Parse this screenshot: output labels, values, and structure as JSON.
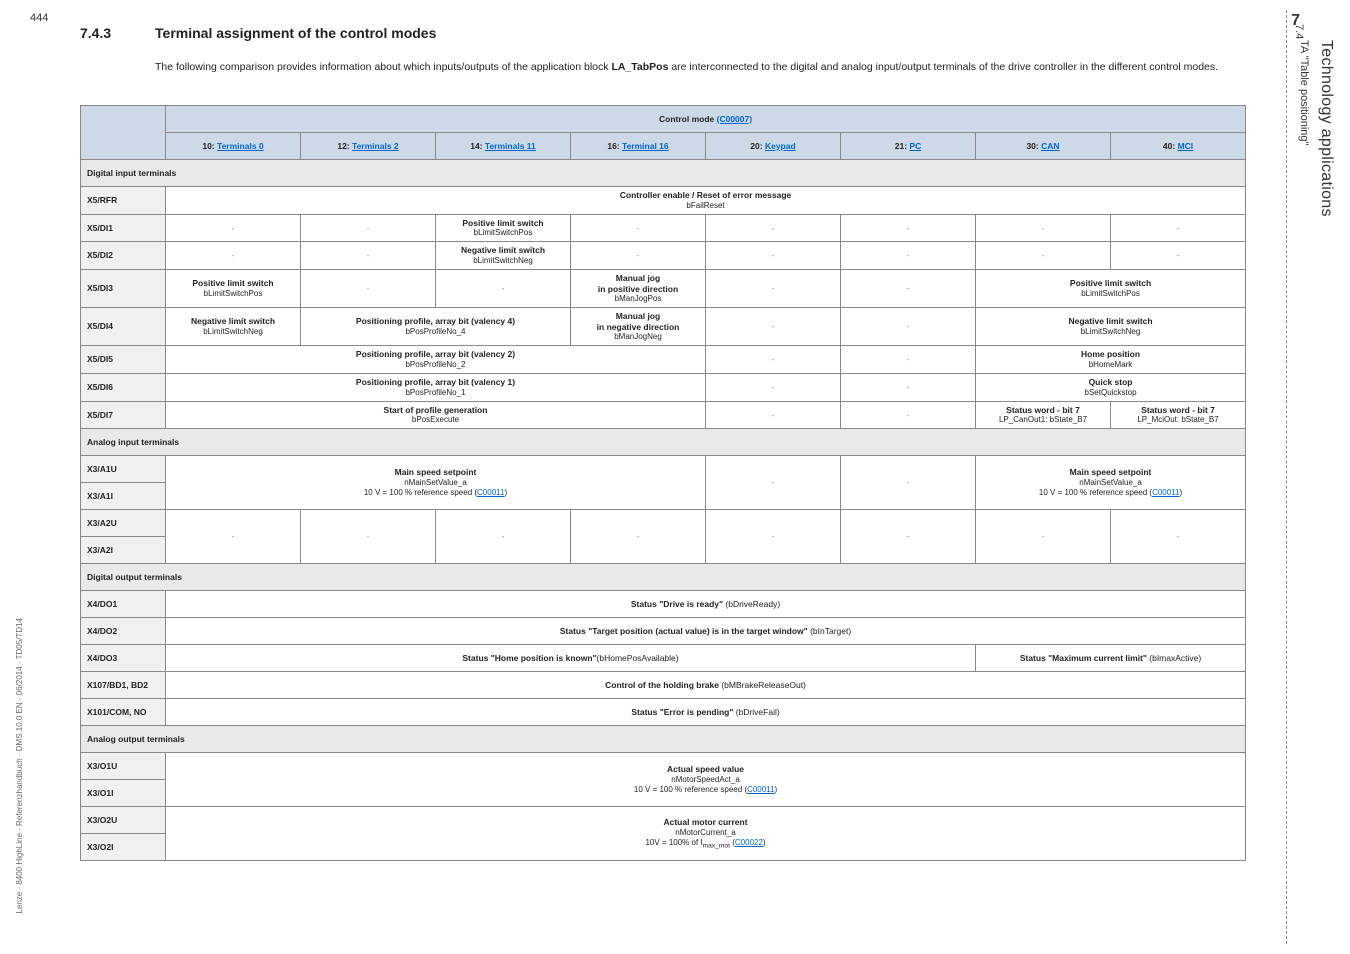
{
  "page_number_top": "444",
  "chapter_num": "7",
  "section_num": "7.4",
  "vertical_title": "Technology applications",
  "vertical_subtitle": "TA \"Table positioning\"",
  "footer": "Lenze · 8400 HighLine · Referenzhandbuch · DMS 10.0 EN · 06/2014 · TD05/TD14",
  "heading_num": "7.4.3",
  "heading_text": "Terminal assignment of the control modes",
  "intro_pre": "The following comparison provides information about which inputs/outputs of the application block ",
  "intro_bold": "LA_TabPos",
  "intro_post": " are interconnected to the digital and analog input/output terminals of the drive controller in the different control modes.",
  "table": {
    "control_mode_header": "Control mode",
    "control_mode_code": "(C00007)",
    "columns": [
      {
        "num": "10:",
        "link": "Terminals 0"
      },
      {
        "num": "12:",
        "link": "Terminals 2"
      },
      {
        "num": "14:",
        "link": "Terminals 11"
      },
      {
        "num": "16:",
        "link": "Terminal 16"
      },
      {
        "num": "20:",
        "link": "Keypad"
      },
      {
        "num": "21:",
        "link": "PC"
      },
      {
        "num": "30:",
        "link": "CAN"
      },
      {
        "num": "40:",
        "link": "MCI"
      }
    ],
    "sections": {
      "digital_in": "Digital input terminals",
      "analog_in": "Analog input terminals",
      "digital_out": "Digital output terminals",
      "analog_out": "Analog output terminals"
    },
    "rows": {
      "x5rfr": {
        "label": "X5/RFR",
        "text": "Controller enable / Reset of error message",
        "sub": "bFailReset"
      },
      "x5di1": {
        "label": "X5/DI1",
        "text": "Positive limit switch",
        "sub": "bLimitSwitchPos"
      },
      "x5di2": {
        "label": "X5/DI2",
        "text": "Negative limit switch",
        "sub": "bLimitSwitchNeg"
      },
      "x5di3": {
        "label": "X5/DI3",
        "c1": "Positive limit switch",
        "c1s": "bLimitSwitchPos",
        "c4": "Manual jog\nin positive direction",
        "c4s": "bManJogPos",
        "c78": "Positive limit switch",
        "c78s": "bLimitSwitchPos"
      },
      "x5di4": {
        "label": "X5/DI4",
        "c1": "Negative limit switch",
        "c1s": "bLimitSwitchNeg",
        "c23": "Positioning profile, array bit (valency 4)",
        "c23s": "bPosProfileNo_4",
        "c4": "Manual jog\nin negative direction",
        "c4s": "bManJogNeg",
        "c78": "Negative limit switch",
        "c78s": "bLimitSwitchNeg"
      },
      "x5di5": {
        "label": "X5/DI5",
        "c14": "Positioning profile, array bit (valency 2)",
        "c14s": "bPosProfileNo_2",
        "c78": "Home position",
        "c78s": "bHomeMark"
      },
      "x5di6": {
        "label": "X5/DI6",
        "c14": "Positioning profile, array bit (valency 1)",
        "c14s": "bPosProfileNo_1",
        "c78": "Quick stop",
        "c78s": "bSetQuickstop"
      },
      "x5di7": {
        "label": "X5/DI7",
        "c14": "Start of profile generation",
        "c14s": "bPosExecute",
        "c7": "Status word - bit 7",
        "c7s": "LP_CanOut1: bState_B7",
        "c8": "Status word - bit 7",
        "c8s": "LP_MciOut: bState_B7"
      },
      "x3a1u": {
        "label": "X3/A1U"
      },
      "x3a1i": {
        "label": "X3/A1I"
      },
      "main_speed": {
        "text": "Main speed setpoint",
        "sub1": "nMainSetValue_a",
        "sub2pre": "10 V = 100 % reference speed (",
        "sub2link": "C00011",
        "sub2post": ")"
      },
      "x3a2u": {
        "label": "X3/A2U"
      },
      "x3a2i": {
        "label": "X3/A2I"
      },
      "x4do1": {
        "label": "X4/DO1",
        "text": "Status \"Drive is ready\"",
        "sub": " (bDriveReady)"
      },
      "x4do2": {
        "label": "X4/DO2",
        "text": "Status \"Target position (actual value) is in the target window\"",
        "sub": " (bInTarget)"
      },
      "x4do3": {
        "label": "X4/DO3",
        "text1": "Status \"Home position is known\"",
        "sub1": "(bHomePosAvailable)",
        "text2": "Status \"Maximum current limit\"",
        "sub2": " (bImaxActive)"
      },
      "x107": {
        "label": "X107/BD1, BD2",
        "text": "Control of the holding brake",
        "sub": " (bMBrakeReleaseOut)"
      },
      "x101": {
        "label": "X101/COM, NO",
        "text": "Status \"Error is pending\"",
        "sub": " (bDriveFail)"
      },
      "x3o1u": {
        "label": "X3/O1U"
      },
      "x3o1i": {
        "label": "X3/O1I"
      },
      "actual_speed": {
        "text": "Actual speed value",
        "sub1": "nMotorSpeedAct_a",
        "sub2pre": "10 V = 100 % reference speed (",
        "sub2link": "C00011",
        "sub2post": ")"
      },
      "x3o2u": {
        "label": "X3/O2U"
      },
      "x3o2i": {
        "label": "X3/O2I"
      },
      "actual_current": {
        "text": "Actual motor current",
        "sub1": "nMotorCurrent_a",
        "sub2pre": "10V = 100% of I",
        "sub2mid": "max_mot",
        "sub2link": "C00022",
        "sub2post": ")"
      }
    }
  }
}
